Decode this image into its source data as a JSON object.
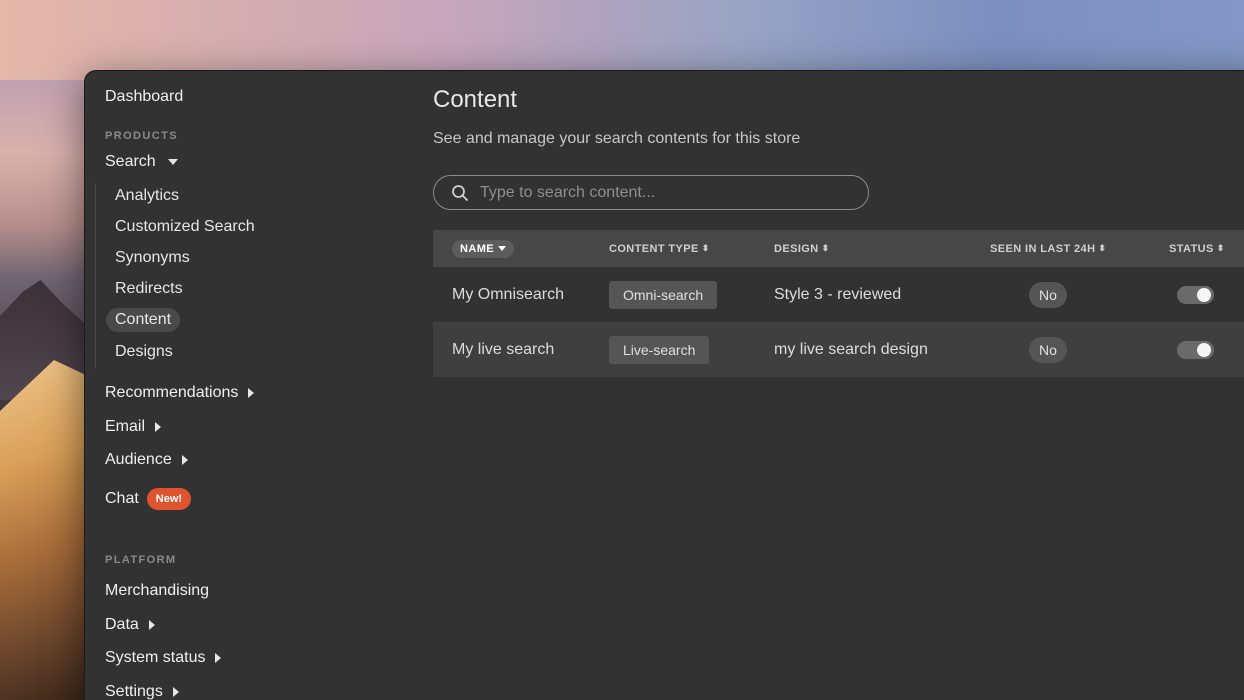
{
  "sidebar": {
    "dashboard": "Dashboard",
    "products_title": "PRODUCTS",
    "search": "Search",
    "search_items": [
      "Analytics",
      "Customized Search",
      "Synonyms",
      "Redirects",
      "Content",
      "Designs"
    ],
    "recommendations": "Recommendations",
    "email": "Email",
    "audience": "Audience",
    "chat": "Chat",
    "chat_badge": "New!",
    "platform_title": "PLATFORM",
    "merchandising": "Merchandising",
    "data": "Data",
    "system_status": "System status",
    "settings": "Settings"
  },
  "main": {
    "title": "Content",
    "subtitle": "See and manage your search contents for this store",
    "search_placeholder": "Type to search content..."
  },
  "table": {
    "columns": [
      "NAME",
      "CONTENT TYPE",
      "DESIGN",
      "SEEN IN LAST 24H",
      "STATUS"
    ],
    "rows": [
      {
        "name": "My Omnisearch",
        "type": "Omni-search",
        "design": "Style 3 - reviewed",
        "seen": "No",
        "status": "on"
      },
      {
        "name": "My live search",
        "type": "Live-search",
        "design": "my live search design",
        "seen": "No",
        "status": "on"
      }
    ]
  },
  "icons": {
    "search": "search-icon",
    "sort": "sort-icon",
    "caret_down": "chevron-down-icon",
    "caret_right": "chevron-right-icon"
  },
  "colors": {
    "window_bg": "#323232",
    "header_bg": "#474747",
    "alt_row_bg": "#3f3f3f",
    "badge_new": "#e0532f"
  }
}
